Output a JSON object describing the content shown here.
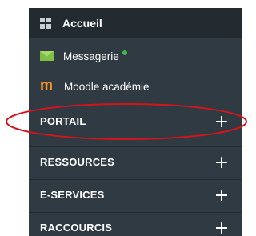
{
  "sidebar": {
    "home": {
      "label": "Accueil",
      "icon": "grid-icon"
    },
    "links": [
      {
        "label": "Messagerie",
        "icon": "mail-icon",
        "status_color": "#41b649"
      },
      {
        "label": "Moodle académie",
        "icon": "moodle-icon",
        "icon_glyph": "m"
      }
    ],
    "sections": [
      {
        "label": "PORTAIL"
      },
      {
        "label": "RESSOURCES"
      },
      {
        "label": "E-SERVICES"
      },
      {
        "label": "RACCOURCIS"
      }
    ]
  },
  "colors": {
    "sidebar_bg": "#2f3a42",
    "header_bg": "#232b30",
    "highlight": "#d4141c",
    "moodle_orange": "#f7931e",
    "mail_green": "#7cc142"
  }
}
